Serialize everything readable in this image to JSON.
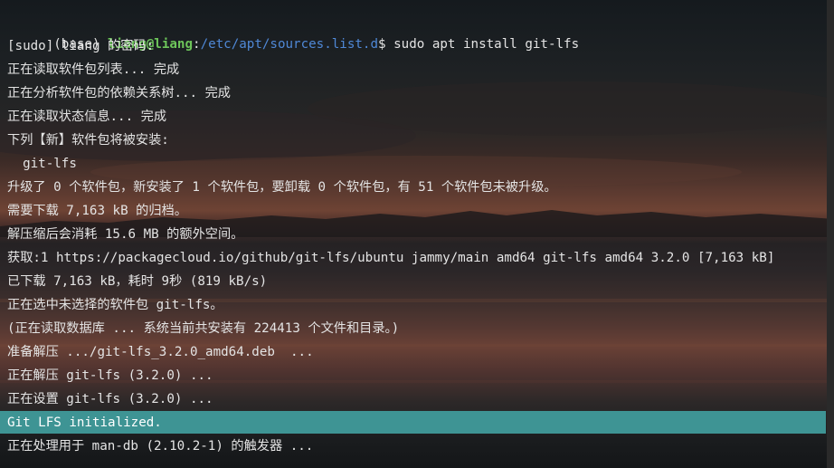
{
  "prompt": {
    "env": "(base)",
    "user_host": "liang@liang",
    "separator": ":",
    "path": "/etc/apt/sources.list.d",
    "symbol": "$",
    "command": " sudo apt install git-lfs"
  },
  "output_lines": [
    "[sudo] liang 的密码:",
    "正在读取软件包列表... 完成",
    "正在分析软件包的依赖关系树... 完成",
    "正在读取状态信息... 完成",
    "下列【新】软件包将被安装:",
    "  git-lfs",
    "升级了 0 个软件包，新安装了 1 个软件包，要卸载 0 个软件包，有 51 个软件包未被升级。",
    "需要下载 7,163 kB 的归档。",
    "解压缩后会消耗 15.6 MB 的额外空间。",
    "获取:1 https://packagecloud.io/github/git-lfs/ubuntu jammy/main amd64 git-lfs amd64 3.2.0 [7,163 kB]",
    "已下载 7,163 kB，耗时 9秒 (819 kB/s)",
    "正在选中未选择的软件包 git-lfs。",
    "(正在读取数据库 ... 系统当前共安装有 224413 个文件和目录。)",
    "准备解压 .../git-lfs_3.2.0_amd64.deb  ...",
    "正在解压 git-lfs (3.2.0) ...",
    "正在设置 git-lfs (3.2.0) ...",
    "Git LFS initialized.",
    "正在处理用于 man-db (2.10.2-1) 的触发器 ..."
  ],
  "colors": {
    "prompt_user": "#6dc55a",
    "prompt_path": "#4f88d6",
    "text": "#e4e4e4",
    "highlight": "#3e9494"
  }
}
